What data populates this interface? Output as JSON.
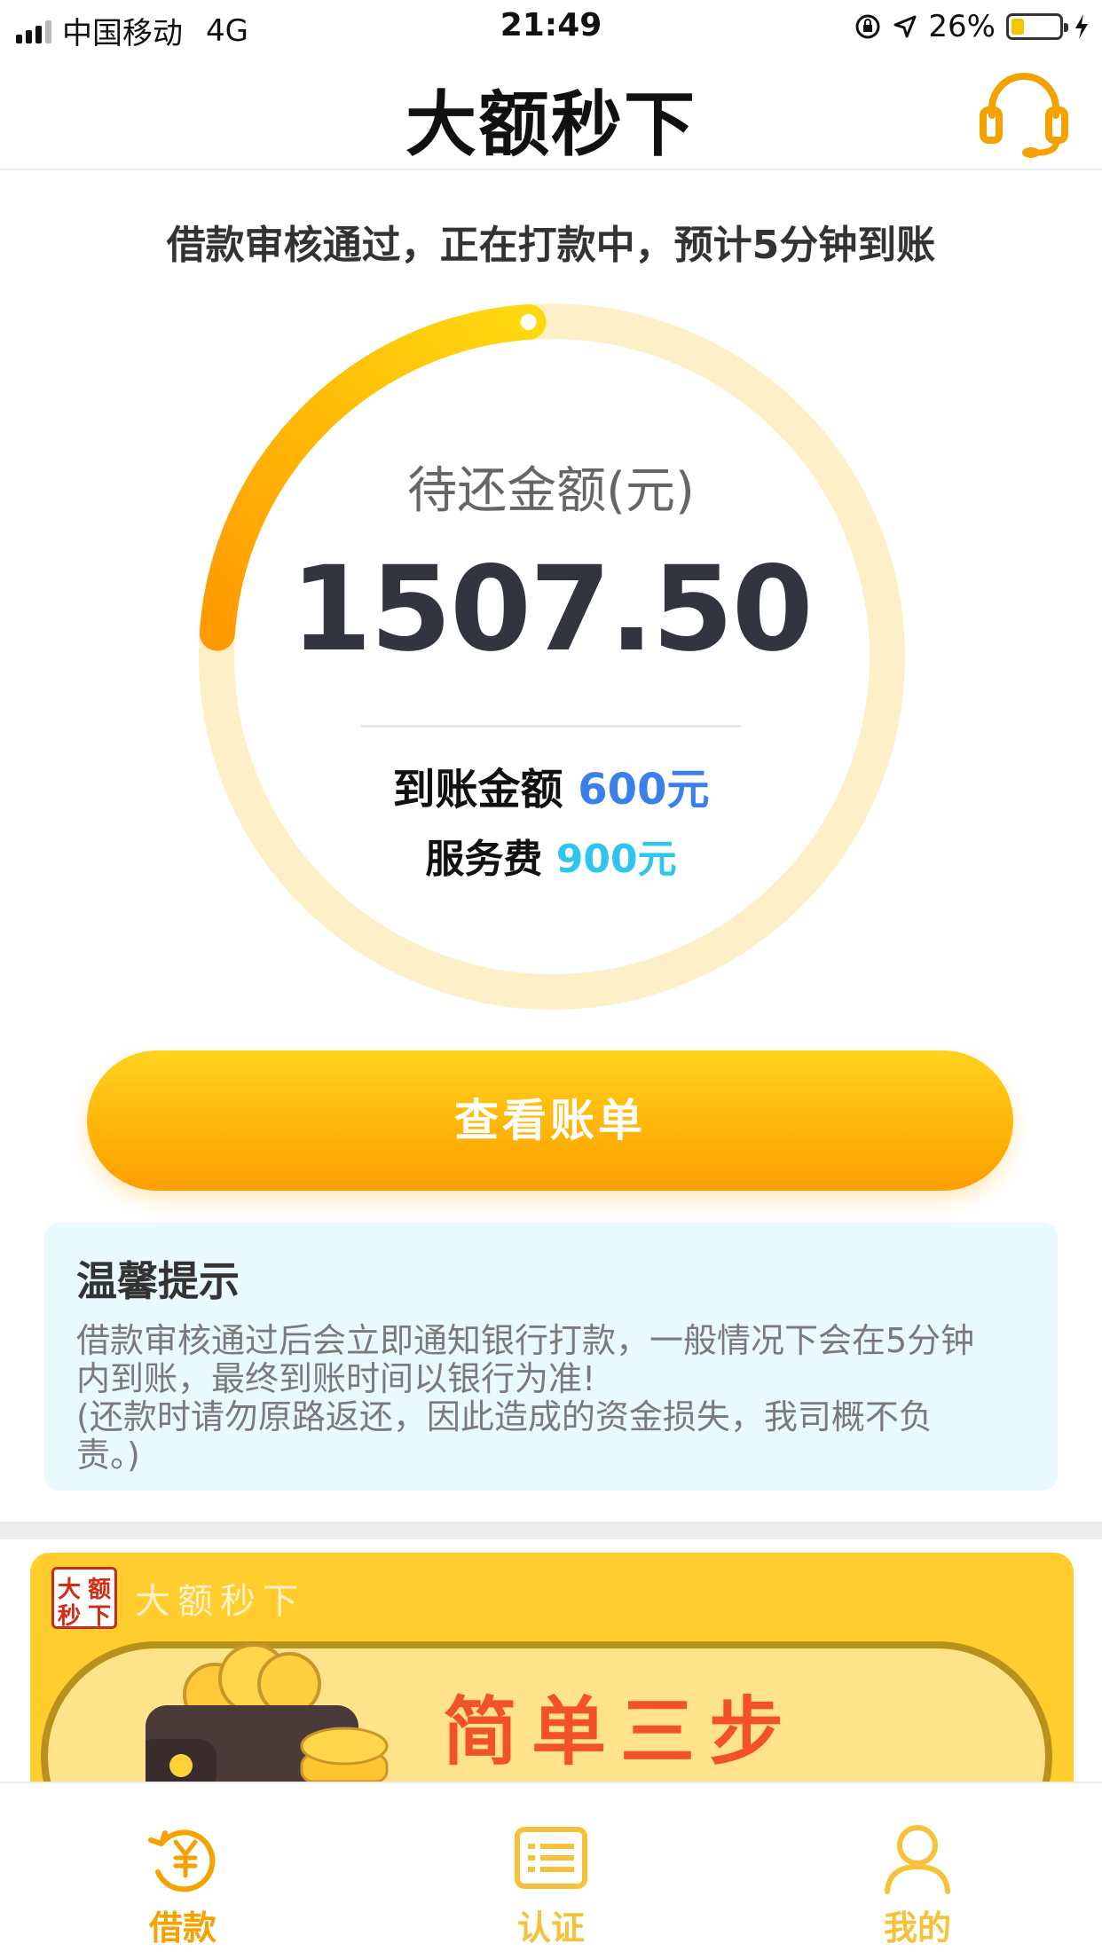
{
  "status_bar": {
    "carrier": "中国移动",
    "network": "4G",
    "time": "21:49",
    "battery": "26%",
    "battery_level": 0.26
  },
  "header": {
    "title": "大额秒下",
    "support_icon": "headset-icon"
  },
  "notice": "借款审核通过，正在打款中，预计5分钟到账",
  "summary": {
    "label": "待还金额(元)",
    "amount": "1507.50",
    "progress": 0.2,
    "received_label": "到账金额",
    "received_value": "600元",
    "fee_label": "服务费",
    "fee_value": "900元"
  },
  "bill_button": "查看账单",
  "tips": {
    "title": "温馨提示",
    "lines": [
      "借款审核通过后会立即通知银行打款，一般情况下会在5分钟",
      "内到账，最终到账时间以银行为准!",
      "(还款时请勿原路返还，因此造成的资金损失，我司概不负",
      "责。)"
    ]
  },
  "banner": {
    "logo_chars": [
      "大",
      "额",
      "秒",
      "下"
    ],
    "brand": "大额秒下",
    "headline": "简单三步"
  },
  "tabs": [
    {
      "label": "借款",
      "icon": "yuan-refresh-icon",
      "color": "#f5a200"
    },
    {
      "label": "认证",
      "icon": "id-card-icon",
      "color": "#f7c23a"
    },
    {
      "label": "我的",
      "icon": "user-icon",
      "color": "#f7c23a"
    }
  ],
  "colors": {
    "accent": "#ffb308",
    "ring_track": "#fdf0c8",
    "blue": "#3b7fe8",
    "cyan": "#2fc6ee"
  }
}
